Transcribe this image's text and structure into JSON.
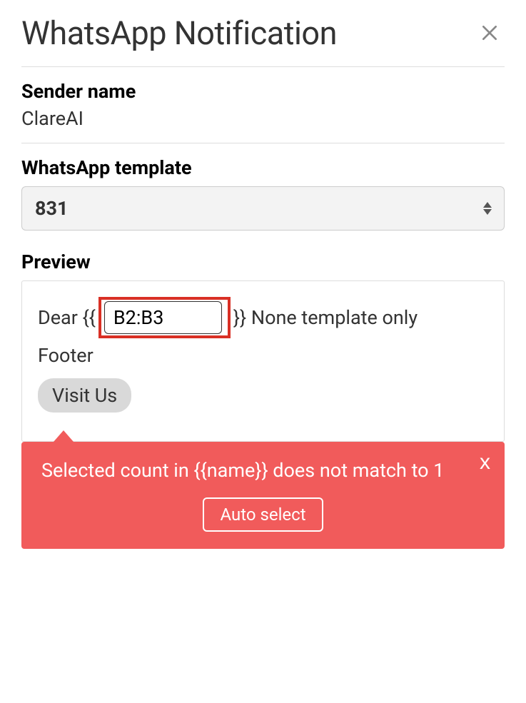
{
  "header": {
    "title": "WhatsApp Notification"
  },
  "sender": {
    "label": "Sender name",
    "value": "ClareAI"
  },
  "template": {
    "label": "WhatsApp template",
    "selected": "831"
  },
  "preview": {
    "label": "Preview",
    "prefix": "Dear {{",
    "var_value": "B2:B3",
    "suffix": "}} None template only",
    "footer": "Footer",
    "button_label": "Visit Us"
  },
  "error": {
    "message": "Selected count in {{name}} does not match to 1",
    "action_label": "Auto select"
  }
}
